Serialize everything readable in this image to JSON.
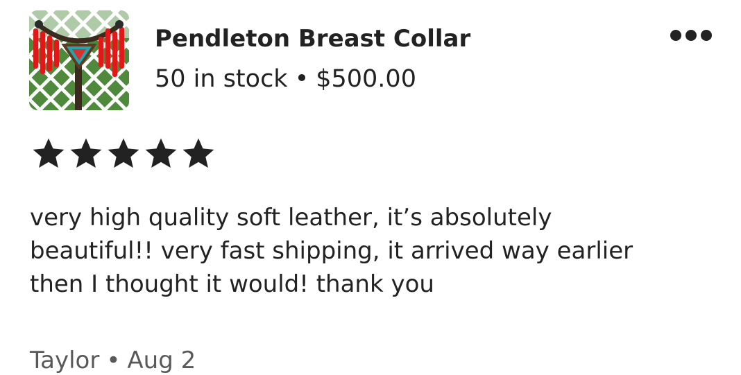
{
  "listing": {
    "title": "Pendleton Breast Collar",
    "stock": "50 in stock",
    "separator": "•",
    "price": "$500.00",
    "thumbnail_icon": "product-thumbnail-image"
  },
  "actions": {
    "more_icon": "more-horizontal-icon"
  },
  "review": {
    "rating": 5,
    "rating_max": 5,
    "star_color": "#222222",
    "lines": [
      "very high quality soft leather, it’s absolutely",
      "beautiful!! very fast shipping, it arrived way earlier",
      "then I thought it would! thank you"
    ],
    "author": "Taylor",
    "date": "Aug 2"
  }
}
